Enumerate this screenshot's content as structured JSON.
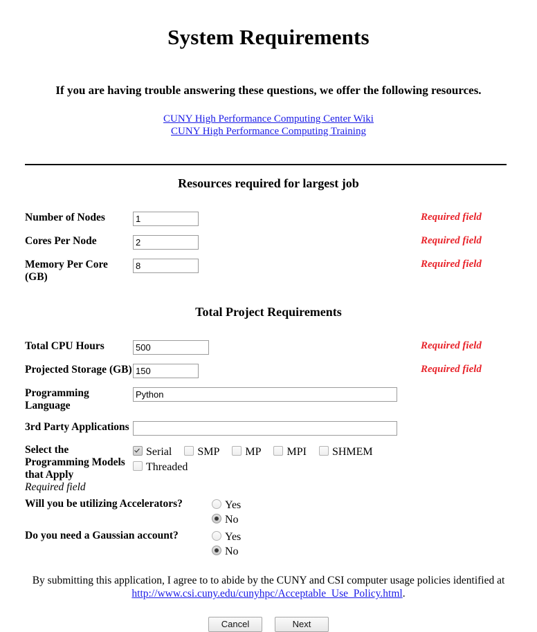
{
  "header": {
    "title": "System Requirements",
    "subtitle": "If you are having trouble answering these questions, we offer the following resources.",
    "links": [
      {
        "label": "CUNY High Performance Computing Center Wiki"
      },
      {
        "label": "CUNY High Performance Computing Training"
      }
    ]
  },
  "sections": [
    {
      "heading": "Resources required for largest job"
    },
    {
      "heading": "Total Project Requirements"
    }
  ],
  "fields": {
    "number_of_nodes": {
      "label": "Number of Nodes",
      "value": "1",
      "required_note": "Required field"
    },
    "cores_per_node": {
      "label": "Cores Per Node",
      "value": "2",
      "required_note": "Required field"
    },
    "memory_per_core": {
      "label": "Memory Per Core (GB)",
      "value": "8",
      "required_note": "Required field"
    },
    "total_cpu_hours": {
      "label": "Total CPU Hours",
      "value": "500",
      "required_note": "Required field"
    },
    "projected_storage": {
      "label": "Projected Storage (GB)",
      "value": "150",
      "required_note": "Required field"
    },
    "programming_language": {
      "label": "Programming Language",
      "value": "Python",
      "required_note": ""
    },
    "third_party_apps": {
      "label": "3rd Party Applications",
      "value": "",
      "required_note": ""
    }
  },
  "programming_models": {
    "label": "Select the Programming Models that Apply",
    "label_note": "Required field",
    "options": [
      {
        "label": "Serial",
        "checked": true
      },
      {
        "label": "SMP",
        "checked": false
      },
      {
        "label": "MP",
        "checked": false
      },
      {
        "label": "MPI",
        "checked": false
      },
      {
        "label": "SHMEM",
        "checked": false
      },
      {
        "label": "Threaded",
        "checked": false
      }
    ]
  },
  "accelerators": {
    "label": "Will you be utilizing Accelerators?",
    "options": [
      {
        "label": "Yes",
        "selected": false
      },
      {
        "label": "No",
        "selected": true
      }
    ]
  },
  "gaussian": {
    "label": "Do you need a Gaussian account?",
    "options": [
      {
        "label": "Yes",
        "selected": false
      },
      {
        "label": "No",
        "selected": true
      }
    ]
  },
  "footer": {
    "agreement_before": "By submitting this application, I agree to to abide by the CUNY and CSI computer usage policies identified at",
    "policy_link": "http://www.csi.cuny.edu/cunyhpc/Acceptable_Use_Policy.html",
    "agreement_after": ".",
    "cancel_label": "Cancel",
    "next_label": "Next"
  },
  "colors": {
    "link": "#1a1ae6",
    "required": "#e8232a",
    "rule": "#000000"
  }
}
